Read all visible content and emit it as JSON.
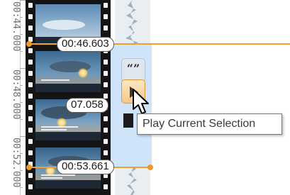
{
  "ruler": {
    "labels": [
      "00:44.000",
      "00:48.000",
      "00:52.000"
    ]
  },
  "filmstrip": {
    "frames": [
      {
        "name": "frame-1"
      },
      {
        "name": "frame-2"
      },
      {
        "name": "frame-3"
      },
      {
        "name": "frame-4"
      }
    ]
  },
  "selection": {
    "start_time": "00:46.603",
    "duration": "07.058",
    "end_time": "00:53.661"
  },
  "buttons": {
    "quote_label": "“”",
    "play_icon": "play-icon",
    "square_icon": "stop-square-icon"
  },
  "tooltip": {
    "text": "Play Current Selection"
  },
  "colors": {
    "selection_fill": "#cfe4f9",
    "selection_marker": "#f0a030",
    "active_button": "#f6c88a"
  }
}
